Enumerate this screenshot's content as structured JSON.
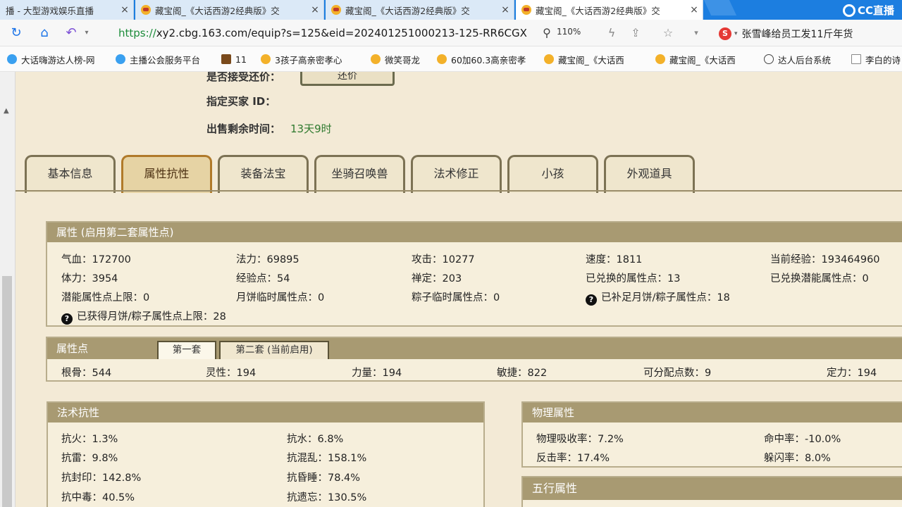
{
  "browser": {
    "tabs": [
      {
        "title": "播 - 大型游戏娱乐直播",
        "active": false
      },
      {
        "title": "藏宝阁_《大话西游2经典版》交",
        "active": false
      },
      {
        "title": "藏宝阁_《大话西游2经典版》交",
        "active": false
      },
      {
        "title": "藏宝阁_《大话西游2经典版》交",
        "active": true
      }
    ],
    "tab_close": "×",
    "brand": "CC直播",
    "url_scheme": "https://",
    "url_rest": "xy2.cbg.163.com/equip?s=125&eid=202401251000213-125-RR6CGX",
    "zoom": "110%",
    "search_text": "张雪峰给员工发11斤年货",
    "bookmarks": [
      {
        "label": "大话嗨游达人榜-网",
        "icon": "blue"
      },
      {
        "label": "主播公会服务平台",
        "icon": "blue"
      },
      {
        "label": "11",
        "icon": "dark"
      },
      {
        "label": "3孩子高亲密孝心",
        "icon": "orange"
      },
      {
        "label": "微笑哥龙",
        "icon": "orange"
      },
      {
        "label": "60加60.3高亲密孝",
        "icon": "orange"
      },
      {
        "label": "藏宝阁_《大话西",
        "icon": "orange"
      },
      {
        "label": "藏宝阁_《大话西",
        "icon": "orange"
      },
      {
        "label": "达人后台系统",
        "icon": "globe"
      },
      {
        "label": "李白的诗",
        "icon": "doc"
      }
    ]
  },
  "trade": {
    "accept_offer_label": "是否接受还价：",
    "offer_button": "还价",
    "buyer_id_label": "指定买家 ID：",
    "remaining_label": "出售剩余时间：",
    "remaining_value": "13天9时"
  },
  "tabs": [
    "基本信息",
    "属性抗性",
    "装备法宝",
    "坐骑召唤兽",
    "法术修正",
    "小孩",
    "外观道具"
  ],
  "active_tab": "属性抗性",
  "attributes": {
    "title": "属性 (启用第二套属性点)",
    "rows": [
      [
        "气血：172700",
        "法力：69895",
        "攻击：10277",
        "速度：1811",
        "当前经验：193464960"
      ],
      [
        "体力：3954",
        "经验点：54",
        "禅定：203",
        "已兑换的属性点：13",
        "已兑换潜能属性点：0"
      ],
      [
        "潜能属性点上限：0",
        "月饼临时属性点：0",
        "粽子临时属性点：0",
        "已补足月饼/粽子属性点：18"
      ]
    ],
    "last": "已获得月饼/粽子属性点上限：28",
    "help": "?"
  },
  "points": {
    "title": "属性点",
    "subtabs": [
      "第一套",
      "第二套 (当前启用)"
    ],
    "values": [
      "根骨：544",
      "灵性：194",
      "力量：194",
      "敏捷：822",
      "可分配点数：9",
      "定力：194"
    ]
  },
  "resist": {
    "title": "法术抗性",
    "rows": [
      [
        "抗火：1.3%",
        "抗水：6.8%"
      ],
      [
        "抗雷：9.8%",
        "抗混乱：158.1%"
      ],
      [
        "抗封印：142.8%",
        "抗昏睡：78.4%"
      ],
      [
        "抗中毒：40.5%",
        "抗遗忘：130.5%"
      ]
    ]
  },
  "physical": {
    "title": "物理属性",
    "rows": [
      [
        "物理吸收率：7.2%",
        "命中率：-10.0%"
      ],
      [
        "反击率：17.4%",
        "躲闪率：8.0%"
      ]
    ]
  },
  "elements": {
    "title": "五行属性"
  }
}
